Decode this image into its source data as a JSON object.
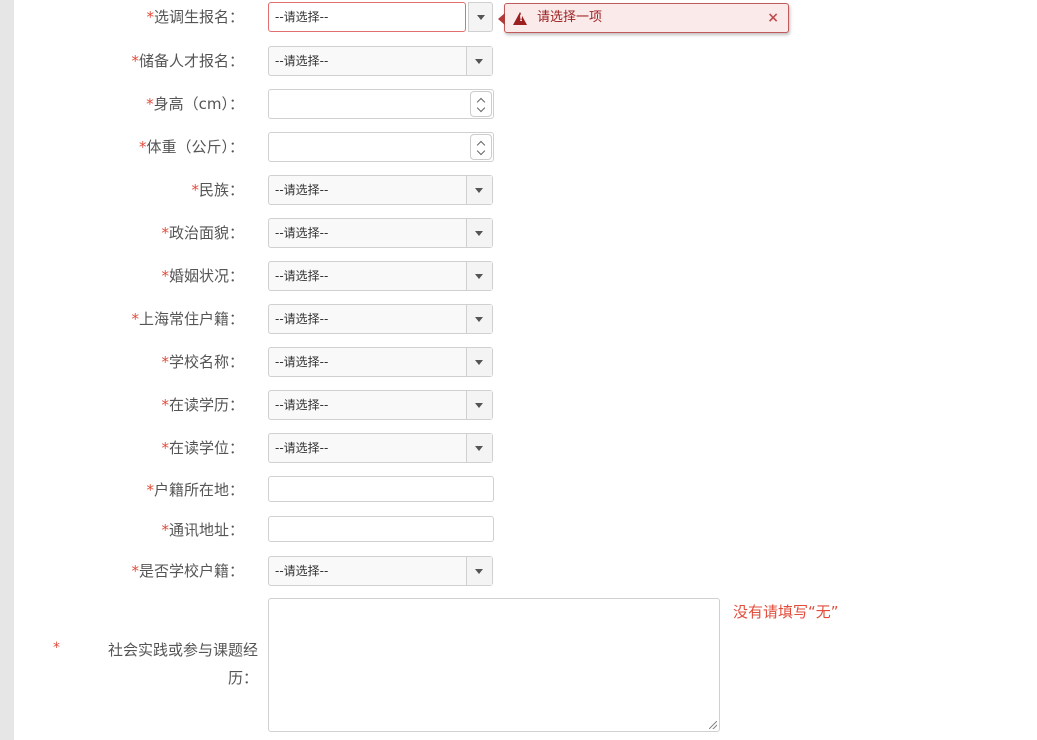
{
  "fields": [
    {
      "label": "选调生报名：",
      "type": "select",
      "value": "--请选择--",
      "error": true
    },
    {
      "label": "储备人才报名：",
      "type": "select",
      "value": "--请选择--"
    },
    {
      "label": "身高（cm）：",
      "type": "number",
      "value": ""
    },
    {
      "label": "体重（公斤）：",
      "type": "number",
      "value": ""
    },
    {
      "label": "民族：",
      "type": "select",
      "value": "--请选择--"
    },
    {
      "label": "政治面貌：",
      "type": "select",
      "value": "--请选择--"
    },
    {
      "label": "婚姻状况：",
      "type": "select",
      "value": "--请选择--"
    },
    {
      "label": "上海常住户籍：",
      "type": "select",
      "value": "--请选择--"
    },
    {
      "label": "学校名称：",
      "type": "select",
      "value": "--请选择--"
    },
    {
      "label": "在读学历：",
      "type": "select",
      "value": "--请选择--"
    },
    {
      "label": "在读学位：",
      "type": "select",
      "value": "--请选择--"
    },
    {
      "label": "户籍所在地：",
      "type": "text",
      "value": ""
    },
    {
      "label": "通讯地址：",
      "type": "text",
      "value": ""
    },
    {
      "label": "是否学校户籍：",
      "type": "select",
      "value": "--请选择--"
    }
  ],
  "required_mark": "*",
  "tooltip": {
    "message": "请选择一项",
    "close": "×",
    "warn_glyph": "!"
  },
  "practice": {
    "required_mark": "*",
    "label": "社会实践或参与课题经历：",
    "value": "",
    "hint": "没有请填写“无”"
  },
  "colors": {
    "required": "#e24c3b",
    "error_border": "#e07070",
    "tooltip_bg": "#fbeaea",
    "tooltip_text": "#9c1e1e"
  }
}
